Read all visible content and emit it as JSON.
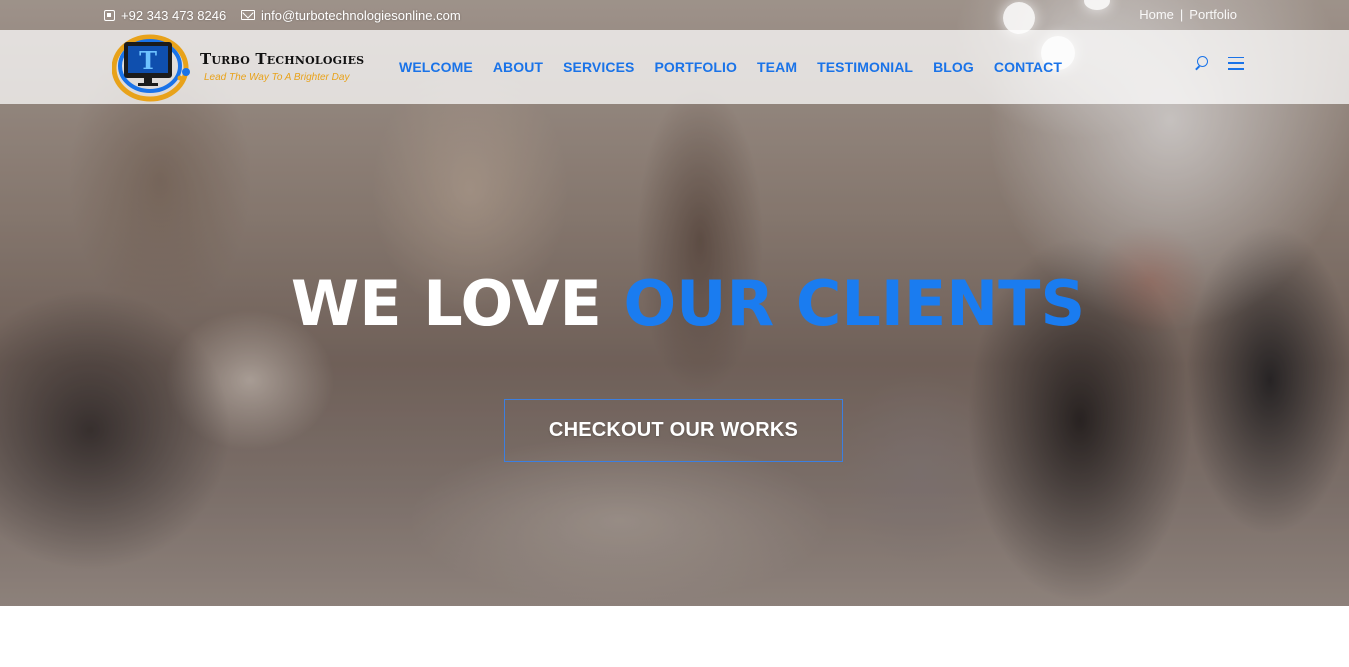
{
  "topbar": {
    "phone": "+92 343 473 8246",
    "email": "info@turbotechnologiesonline.com",
    "breadcrumb": [
      "Home",
      "Portfolio"
    ]
  },
  "brand": {
    "name": "Turbo Technologies",
    "tagline": "Lead The Way To A Brighter Day",
    "logo_letter": "T"
  },
  "nav": {
    "items": [
      "WELCOME",
      "ABOUT",
      "SERVICES",
      "PORTFOLIO",
      "TEAM",
      "TESTIMONIAL",
      "BLOG",
      "CONTACT"
    ],
    "search_icon": "search-icon",
    "menu_icon": "menu-icon"
  },
  "hero": {
    "headline_white": "WE LOVE",
    "headline_blue": "OUR CLIENTS",
    "cta_label": "CHECKOUT OUR WORKS"
  },
  "colors": {
    "accent": "#1a73e8",
    "headline_blue": "#1a7cf0",
    "tagline": "#e8a21a"
  }
}
